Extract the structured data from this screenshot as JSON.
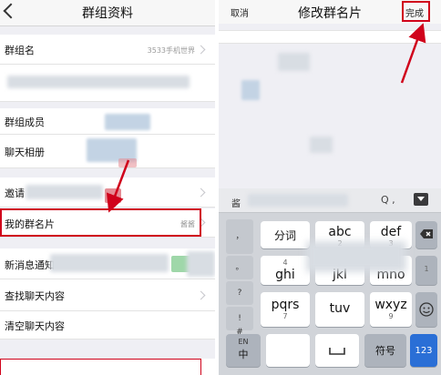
{
  "left": {
    "title": "群组资料",
    "rows": [
      {
        "label": "群组名",
        "value": "3533手机世界"
      },
      {
        "label": "群组成员"
      },
      {
        "label": "聊天相册"
      },
      {
        "label": "邀请"
      },
      {
        "label": "我的群名片",
        "value": "酱酱"
      },
      {
        "label": "新消息通知"
      },
      {
        "label": "查找聊天内容"
      },
      {
        "label": "清空聊天内容"
      }
    ]
  },
  "right": {
    "cancel": "取消",
    "title": "修改群名片",
    "done": "完成",
    "keyboard": {
      "candidate": "酱",
      "search_icon": "Q ,",
      "side_keys": [
        "，",
        "。",
        "?",
        "!",
        "#"
      ],
      "rows": [
        [
          {
            "main": "分词"
          },
          {
            "main": "abc",
            "sub": "2"
          },
          {
            "main": "def",
            "sub": "3"
          }
        ],
        [
          {
            "main": "ghi",
            "sub": "4"
          },
          {
            "main": "jkl",
            "sub": "5"
          },
          {
            "main": "mno",
            "sub": "6"
          }
        ],
        [
          {
            "main": "pqrs",
            "sub": "7"
          },
          {
            "main": "tuv",
            "sub": "8"
          },
          {
            "main": "wxyz",
            "sub": "9"
          }
        ]
      ],
      "bottom": {
        "lang_en": "EN",
        "lang_zh": "中",
        "symbols": "符号",
        "numbers": "123"
      },
      "right_top_sub": "1"
    }
  },
  "colors": {
    "highlight": "#d0021b",
    "background": "#efeff4"
  }
}
